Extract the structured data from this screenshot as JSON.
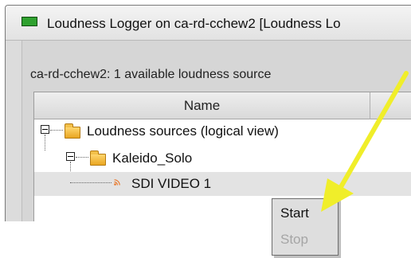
{
  "window": {
    "title": "Loudness Logger on ca-rd-cchew2 [Loudness Lo"
  },
  "panel": {
    "summary": "ca-rd-cchew2: 1 available loudness source"
  },
  "table": {
    "columns": [
      "Name"
    ],
    "rows": [
      {
        "label": "Loudness sources (logical view)",
        "level": 0,
        "expanded": true,
        "icon": "folder-icon"
      },
      {
        "label": "Kaleido_Solo",
        "level": 1,
        "expanded": true,
        "icon": "folder-icon"
      },
      {
        "label": "SDI VIDEO 1",
        "level": 2,
        "icon": "rss-source-icon",
        "selected": true
      }
    ]
  },
  "context_menu": {
    "items": [
      {
        "label": "Start",
        "enabled": true
      },
      {
        "label": "Stop",
        "enabled": false
      }
    ]
  },
  "colors": {
    "arrow": "#f0ee2a",
    "title_icon": "#2fa12f",
    "folder": "#f2b93b"
  }
}
